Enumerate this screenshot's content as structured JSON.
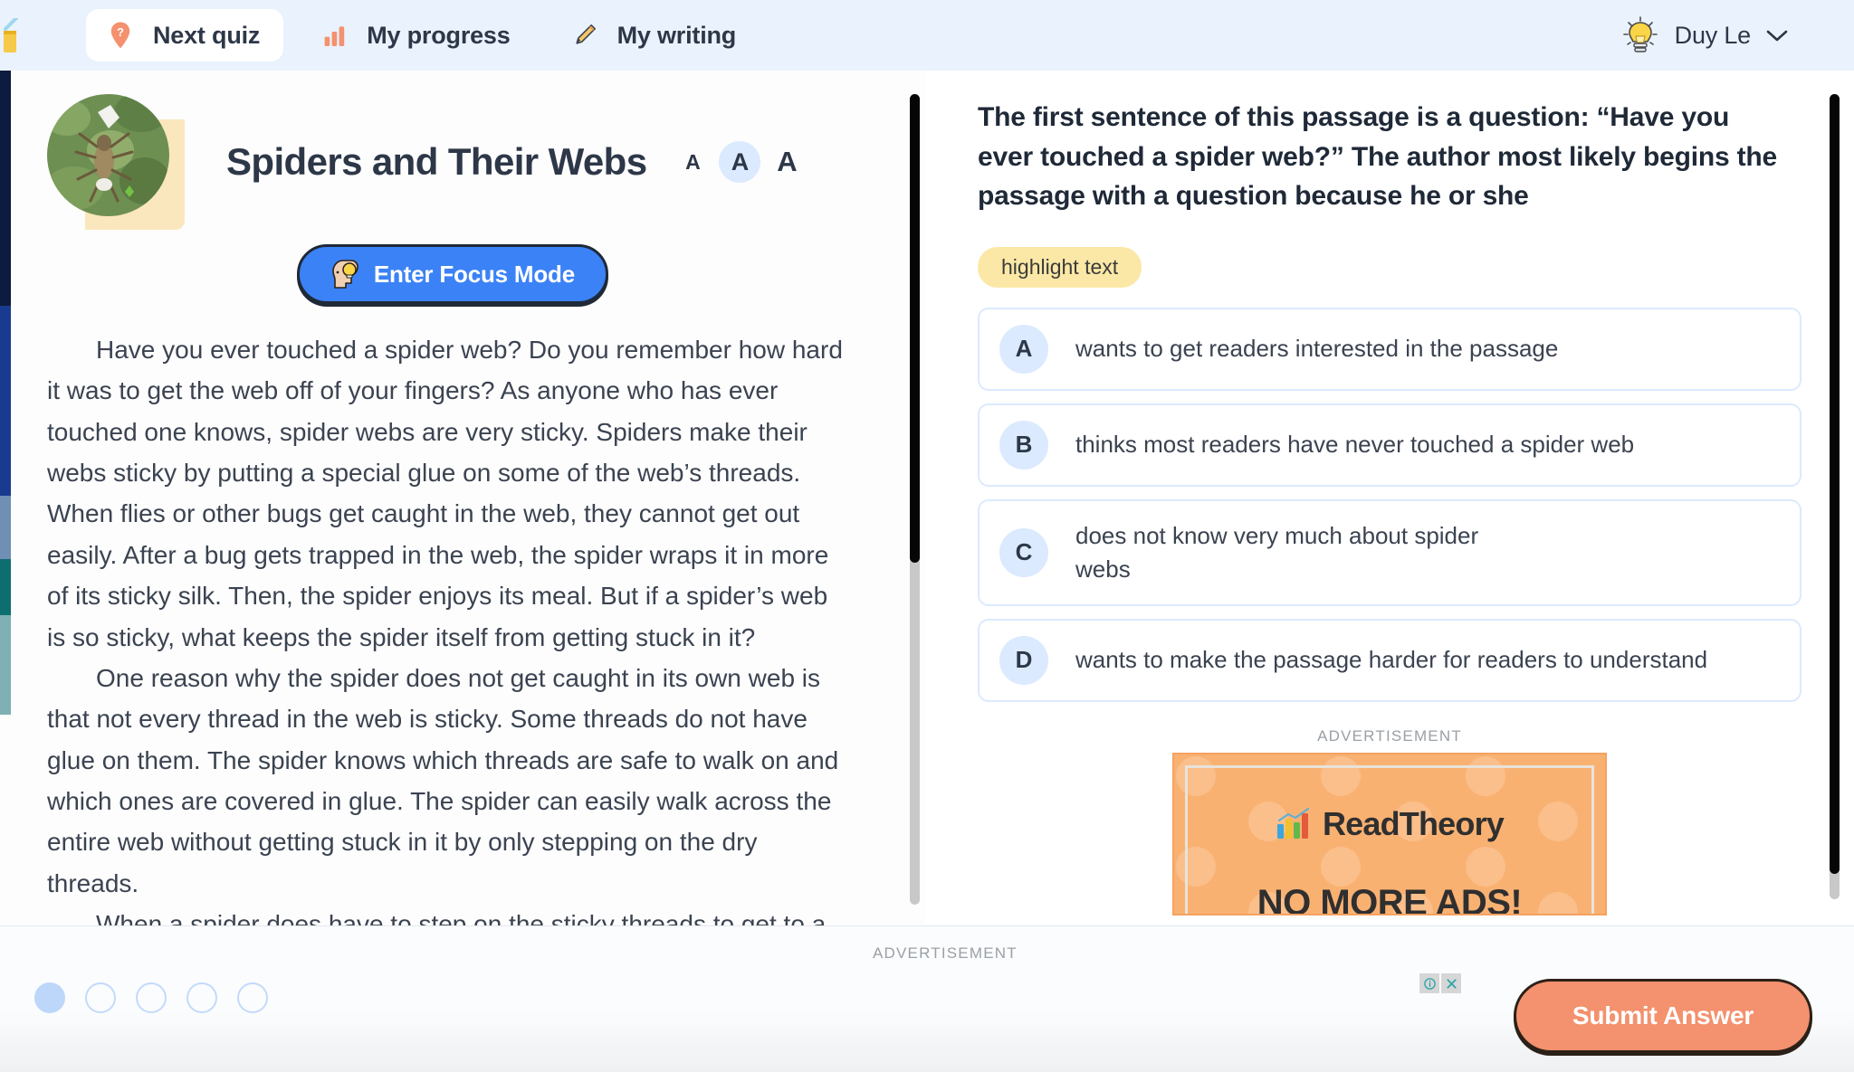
{
  "header": {
    "logo_icon": "pencil-logo-icon",
    "tabs": [
      {
        "label": "Next quiz",
        "icon": "question-pin-icon",
        "active": true
      },
      {
        "label": "My progress",
        "icon": "bar-chart-icon",
        "active": false
      },
      {
        "label": "My writing",
        "icon": "pencil-icon",
        "active": false
      }
    ],
    "user": {
      "name": "Duy Le",
      "icon": "lightbulb-icon",
      "chevron": "chevron-down-icon"
    },
    "background_color": "#eaf2fd"
  },
  "passage": {
    "title": "Spiders and Their Webs",
    "thumbnail_icon": "spider-photo-thumbnail",
    "font_sizes": [
      {
        "label": "A",
        "size": "small",
        "selected": false
      },
      {
        "label": "A",
        "size": "medium",
        "selected": true
      },
      {
        "label": "A",
        "size": "large",
        "selected": false
      }
    ],
    "focus_button": {
      "label": "Enter Focus Mode",
      "icon": "head-with-lightbulb-icon",
      "color": "#3b82f6"
    },
    "paragraphs": [
      "Have you ever touched a spider web? Do you remember how hard it was to get the web off of your fingers? As anyone who has ever touched one knows, spider webs are very sticky. Spiders make their webs sticky by putting a special glue on some of the web’s threads. When flies or other bugs get caught in the web, they cannot get out easily. After a bug gets trapped in the web, the spider wraps it in more of its sticky silk. Then, the spider enjoys its meal. But if a spider’s web is so sticky, what keeps the spider itself from getting stuck in it?",
      "One reason why the spider does not get caught in its own web is that not every thread in the web is sticky. Some threads do not have glue on them. The spider knows which threads are safe to walk on and which ones are covered in glue. The spider can easily walk across the entire web without getting stuck in it by only stepping on the dry threads.",
      "When a spider does have to step on the sticky threads to get to a trapped bug, it walks very carefully. A spider will use only the very tips of its"
    ]
  },
  "question": {
    "text": "The first sentence of this passage is a question: “Have you ever touched a spider web?” The author most likely begins the passage with a question because he or she",
    "highlight_badge": "highlight text",
    "choices": [
      {
        "letter": "A",
        "text": "wants to get readers interested in the passage"
      },
      {
        "letter": "B",
        "text": "thinks most readers have never touched a spider web"
      },
      {
        "letter": "C",
        "text": "does not know very much about spider webs"
      },
      {
        "letter": "D",
        "text": "wants to make the passage harder for readers to understand"
      }
    ]
  },
  "inline_ad": {
    "caption": "ADVERTISEMENT",
    "brand": "ReadTheory",
    "brand_icon": "readtheory-bar-chart-logo",
    "tagline": "NO MORE ADS!",
    "background_color": "#f9b172"
  },
  "bottom_bar": {
    "progress_dots": [
      {
        "index": 1,
        "filled": true
      },
      {
        "index": 2,
        "filled": false
      },
      {
        "index": 3,
        "filled": false
      },
      {
        "index": 4,
        "filled": false
      },
      {
        "index": 5,
        "filled": false
      }
    ],
    "ad_caption": "ADVERTISEMENT",
    "ad_info_icon": "info-icon",
    "ad_close_icon": "close-icon",
    "submit_label": "Submit Answer",
    "submit_color": "#f4916e"
  }
}
